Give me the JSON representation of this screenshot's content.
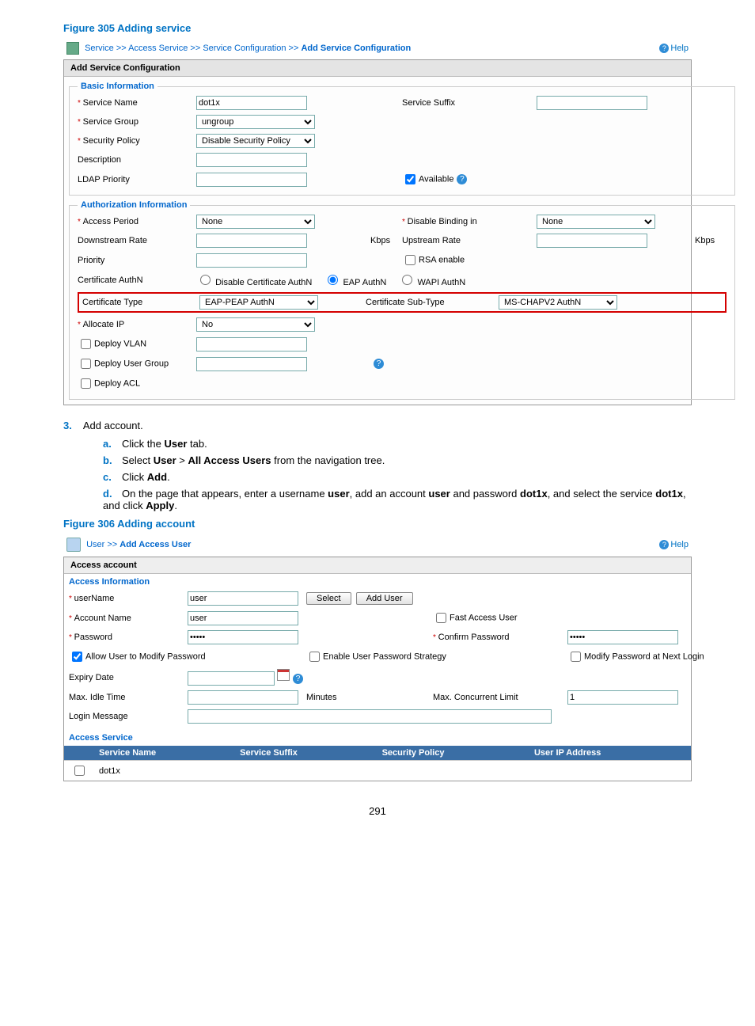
{
  "figure305": {
    "title": "Figure 305 Adding service",
    "breadcrumb": {
      "part1": "Service",
      "sep": ">>",
      "part2": "Access Service",
      "part3": "Service Configuration",
      "part4": "Add Service Configuration"
    },
    "help": "Help",
    "panelTitle": "Add Service Configuration",
    "basic": {
      "legend": "Basic Information",
      "serviceNameLbl": "Service Name",
      "serviceNameVal": "dot1x",
      "serviceSuffixLbl": "Service Suffix",
      "serviceGroupLbl": "Service Group",
      "serviceGroupVal": "ungroup",
      "securityPolicyLbl": "Security Policy",
      "securityPolicyVal": "Disable Security Policy",
      "descriptionLbl": "Description",
      "ldapPriorityLbl": "LDAP Priority",
      "availableLbl": "Available"
    },
    "auth": {
      "legend": "Authorization Information",
      "accessPeriodLbl": "Access Period",
      "accessPeriodVal": "None",
      "disableBindingLbl": "Disable Binding in",
      "disableBindingVal": "None",
      "downstreamLbl": "Downstream Rate",
      "upstreamLbl": "Upstream Rate",
      "kbps": "Kbps",
      "priorityLbl": "Priority",
      "rsaLbl": "RSA enable",
      "certAuthNLbl": "Certificate AuthN",
      "radioDisable": "Disable Certificate AuthN",
      "radioEap": "EAP AuthN",
      "radioWapi": "WAPI AuthN",
      "certTypeLbl": "Certificate Type",
      "certTypeVal": "EAP-PEAP AuthN",
      "certSubTypeLbl": "Certificate Sub-Type",
      "certSubTypeVal": "MS-CHAPV2 AuthN",
      "allocateIpLbl": "Allocate IP",
      "allocateIpVal": "No",
      "deployVlanLbl": "Deploy VLAN",
      "deployUserGroupLbl": "Deploy User Group",
      "deployAclLbl": "Deploy ACL"
    }
  },
  "step3": {
    "num": "3.",
    "text": "Add account.",
    "a": "Click the ",
    "a_bold": "User",
    "a_tail": " tab.",
    "b": "Select ",
    "b_bold1": "User",
    "b_mid": " > ",
    "b_bold2": "All Access Users",
    "b_tail": " from the navigation tree.",
    "c": "Click ",
    "c_bold": "Add",
    "c_tail": ".",
    "d": "On the page that appears, enter a username ",
    "d_bold1": "user",
    "d_mid1": ", add an account ",
    "d_bold2": "user",
    "d_mid2": " and password ",
    "d_bold3": "dot1x",
    "d_mid3": ", and select the service ",
    "d_bold4": "dot1x",
    "d_tail": ", and click ",
    "d_bold5": "Apply",
    "d_end": "."
  },
  "figure306": {
    "title": "Figure 306 Adding account",
    "breadcrumb": {
      "part1": "User",
      "sep": ">>",
      "part2": "Add Access User"
    },
    "help": "Help",
    "panelTitle": "Access account",
    "info": {
      "section": "Access Information",
      "userNameLbl": "userName",
      "userNameVal": "user",
      "selectBtn": "Select",
      "addUserBtn": "Add User",
      "accountNameLbl": "Account Name",
      "accountNameVal": "user",
      "fastAccessLbl": "Fast Access User",
      "passwordLbl": "Password",
      "passwordVal": "•••••",
      "confirmPasswordLbl": "Confirm Password",
      "confirmPasswordVal": "•••••",
      "allowModify": "Allow User to Modify Password",
      "enableStrategy": "Enable User Password Strategy",
      "modifyNext": "Modify Password at Next Login",
      "expiryDateLbl": "Expiry Date",
      "maxIdleLbl": "Max. Idle Time",
      "minutes": "Minutes",
      "maxConcurrentLbl": "Max. Concurrent Limit",
      "maxConcurrentVal": "1",
      "loginMsgLbl": "Login Message"
    },
    "service": {
      "section": "Access Service",
      "col1": "Service Name",
      "col2": "Service Suffix",
      "col3": "Security Policy",
      "col4": "User IP Address",
      "row1": "dot1x"
    }
  },
  "pageNumber": "291"
}
